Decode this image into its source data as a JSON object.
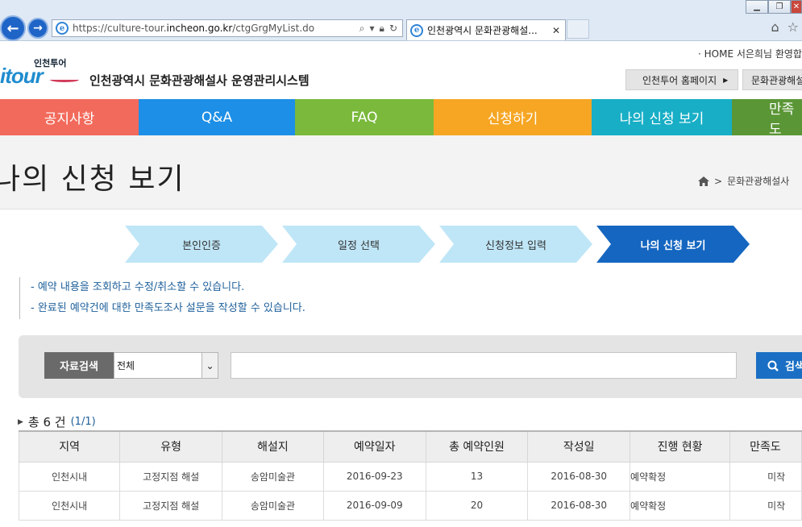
{
  "browser": {
    "url_prefix": "https://culture-tour.",
    "url_host": "incheon.go.kr",
    "url_path": "/ctgGrgMyList.do",
    "tab_title": "인천광역시 문화관광해설...",
    "icons": [
      "back-icon",
      "forward-icon",
      "search-icon",
      "lock-icon",
      "refresh-icon",
      "home-icon",
      "star-icon"
    ]
  },
  "header": {
    "util": "· HOME 서은희님 환영합",
    "logo_sub": "인천투어",
    "logo_main": "tour",
    "logo_i": "i",
    "site_title": "인천광역시 문화관광해설사 운영관리시스템",
    "btn_homepage": "인천투어 홈페이지",
    "btn_other": "문화관광해설"
  },
  "gnb": [
    {
      "label": "공지사항",
      "color": "#f26a5b"
    },
    {
      "label": "Q&A",
      "color": "#1d8fe6"
    },
    {
      "label": "FAQ",
      "color": "#7ab93c"
    },
    {
      "label": "신청하기",
      "color": "#f6a623"
    },
    {
      "label": "나의 신청 보기",
      "color": "#17aec6"
    },
    {
      "label": "만족도",
      "color": "#5a9636"
    }
  ],
  "page": {
    "title": "나의 신청 보기",
    "breadcrumb": "문화관광해설사"
  },
  "steps": [
    {
      "label": "본인인증",
      "active": false
    },
    {
      "label": "일정 선택",
      "active": false
    },
    {
      "label": "신청정보 입력",
      "active": false
    },
    {
      "label": "나의 신청 보기",
      "active": true
    }
  ],
  "notice": [
    "- 예약 내용을 조회하고 수정/취소할 수 있습니다.",
    "- 완료된 예약건에 대한 만족도조사 설문을 작성할 수 있습니다."
  ],
  "search": {
    "label": "자료검색",
    "select_value": "전체",
    "input_value": "",
    "button": "검색"
  },
  "count": {
    "text": "총 6 건",
    "pages": "(1/1)"
  },
  "table": {
    "headers": [
      "지역",
      "유형",
      "해설지",
      "예약일자",
      "총 예약인원",
      "작성일",
      "진행 현황",
      "만족도"
    ],
    "rows": [
      [
        "인천시내",
        "고정지점 해설",
        "송암미술관",
        "2016-09-23",
        "13",
        "2016-08-30",
        "예약확정",
        "미작"
      ],
      [
        "인천시내",
        "고정지점 해설",
        "송암미술관",
        "2016-09-09",
        "20",
        "2016-08-30",
        "예약확정",
        "미작"
      ]
    ]
  },
  "colors": {
    "step_inactive": "#bfe6f7",
    "step_active": "#1566c0",
    "search_button": "#1a6fc4",
    "notice_text": "#1d5f9a"
  }
}
